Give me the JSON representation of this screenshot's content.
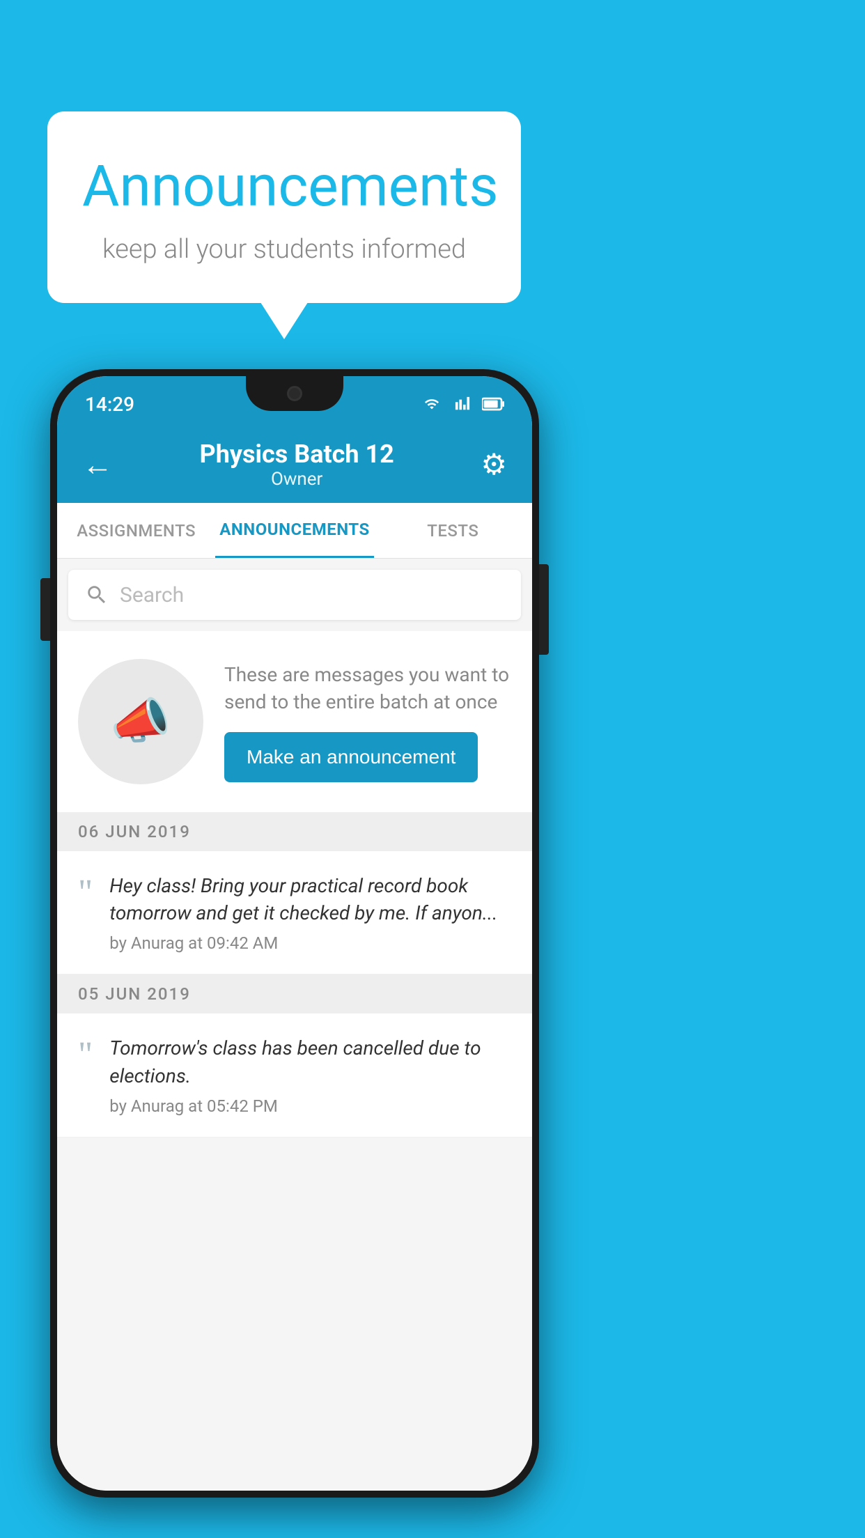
{
  "background_color": "#1cb8e8",
  "speech_bubble": {
    "title": "Announcements",
    "subtitle": "keep all your students informed"
  },
  "phone": {
    "status_bar": {
      "time": "14:29"
    },
    "header": {
      "title": "Physics Batch 12",
      "subtitle": "Owner",
      "back_label": "←",
      "gear_label": "⚙"
    },
    "tabs": [
      {
        "label": "ASSIGNMENTS",
        "active": false
      },
      {
        "label": "ANNOUNCEMENTS",
        "active": true
      },
      {
        "label": "TESTS",
        "active": false
      }
    ],
    "search": {
      "placeholder": "Search"
    },
    "promo": {
      "description": "These are messages you want to send to the entire batch at once",
      "button_label": "Make an announcement"
    },
    "announcements": [
      {
        "date": "06  JUN  2019",
        "message": "Hey class! Bring your practical record book tomorrow and get it checked by me. If anyon...",
        "author": "by Anurag at 09:42 AM"
      },
      {
        "date": "05  JUN  2019",
        "message": "Tomorrow's class has been cancelled due to elections.",
        "author": "by Anurag at 05:42 PM"
      }
    ]
  }
}
